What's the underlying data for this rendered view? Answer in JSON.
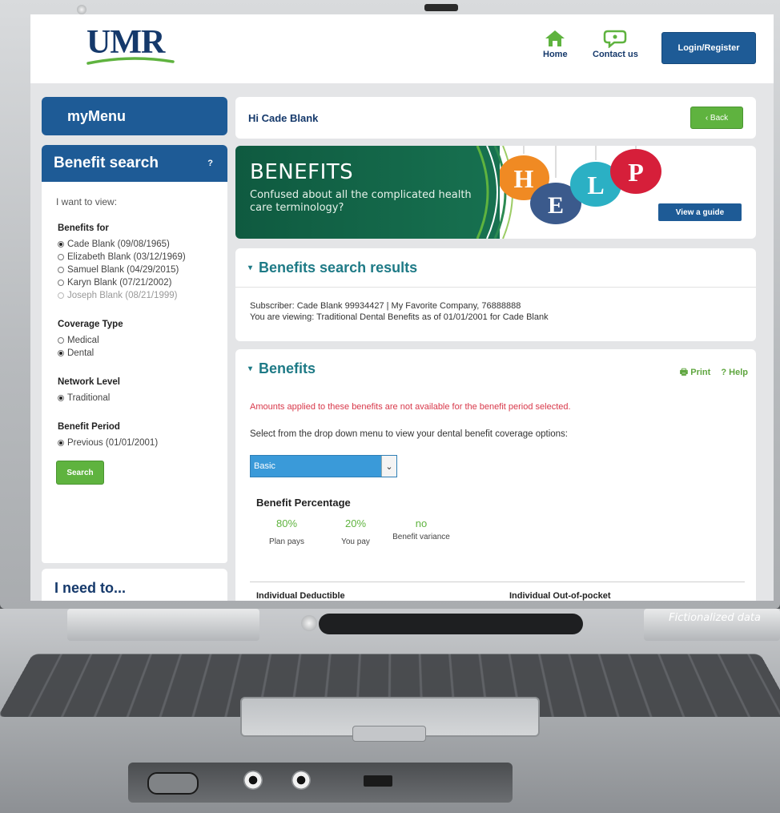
{
  "header": {
    "logo_text": "UMR",
    "nav": [
      {
        "label": "Home",
        "icon": "home-icon"
      },
      {
        "label": "Contact us",
        "icon": "chat-bubble-icon"
      }
    ],
    "login_label": "Login/Register"
  },
  "sidebar": {
    "menu_title": "myMenu",
    "search_title": "Benefit search",
    "search_help_glyph": "?",
    "intro": "I want to view:",
    "benefits_for": {
      "title": "Benefits for",
      "options": [
        {
          "label": "Cade Blank (09/08/1965)",
          "selected": true,
          "disabled": false
        },
        {
          "label": "Elizabeth Blank (03/12/1969)",
          "selected": false,
          "disabled": false
        },
        {
          "label": "Samuel Blank (04/29/2015)",
          "selected": false,
          "disabled": false
        },
        {
          "label": "Karyn Blank (07/21/2002)",
          "selected": false,
          "disabled": false
        },
        {
          "label": "Joseph Blank (08/21/1999)",
          "selected": false,
          "disabled": true
        }
      ]
    },
    "coverage_type": {
      "title": "Coverage Type",
      "options": [
        {
          "label": "Medical",
          "selected": false
        },
        {
          "label": "Dental",
          "selected": true
        }
      ]
    },
    "network_level": {
      "title": "Network Level",
      "options": [
        {
          "label": "Traditional",
          "selected": true
        }
      ]
    },
    "benefit_period": {
      "title": "Benefit Period",
      "options": [
        {
          "label": "Previous (01/01/2001)",
          "selected": true
        }
      ]
    },
    "search_button": "Search",
    "need_title": "I need to..."
  },
  "main": {
    "greeting": "Hi Cade Blank",
    "back_label": "‹ Back",
    "banner": {
      "title": "BENEFITS",
      "subtitle": "Confused about all the complicated health care terminology?",
      "letters": [
        "H",
        "E",
        "L",
        "P"
      ],
      "letter_colors": [
        "#f08a23",
        "#3b5a8c",
        "#2bb0c4",
        "#d61f3a"
      ],
      "guide_button": "View a guide"
    },
    "results": {
      "title": "Benefits search results",
      "subscriber_line": "Subscriber: Cade Blank 99934427 | My Favorite Company, 76888888",
      "viewing_line": "You are viewing: Traditional Dental Benefits as of 01/01/2001 for Cade Blank"
    },
    "benefits": {
      "title": "Benefits",
      "print_label": "Print",
      "help_label": "? Help",
      "warning": "Amounts applied to these benefits are not available for the benefit period selected.",
      "select_hint": "Select from the drop down menu to view your dental benefit coverage options:",
      "dropdown_value": "Basic",
      "percentage_title": "Benefit Percentage",
      "percentages": [
        {
          "value": "80%",
          "label": "Plan pays"
        },
        {
          "value": "20%",
          "label": "You pay"
        },
        {
          "value": "no",
          "label": "Benefit variance"
        }
      ],
      "col_deductible": "Individual Deductible",
      "col_oop": "Individual Out-of-pocket"
    }
  },
  "caption": "Fictionalized data",
  "colors": {
    "brand_blue": "#1e5b96",
    "teal_heading": "#1e7a86",
    "green_button": "#5fb33f",
    "warning_red": "#d8384a",
    "banner_green": "#0f5a40"
  }
}
